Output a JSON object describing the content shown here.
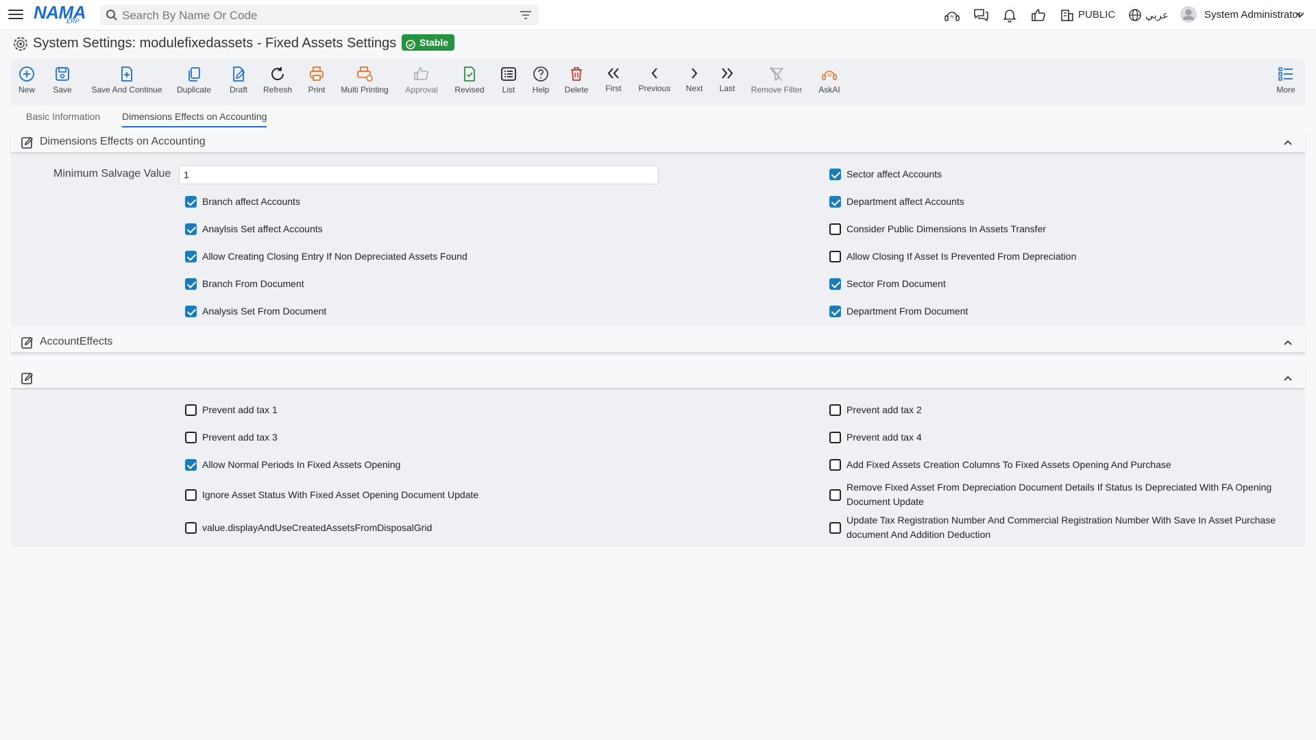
{
  "header": {
    "logo_text": "NAMA",
    "logo_sub": "ERP",
    "search_placeholder": "Search By Name Or Code",
    "public_label": "PUBLIC",
    "language_label": "عربي",
    "user_name": "System Administrator"
  },
  "page": {
    "title": "System Settings: modulefixedassets - Fixed Assets Settings",
    "status_badge": "Stable"
  },
  "toolbar": {
    "buttons": [
      {
        "label": "New",
        "icon": "plus-circle-icon",
        "color": "#1c6fd1"
      },
      {
        "label": "Save",
        "icon": "save-icon",
        "color": "#1c6fd1"
      },
      {
        "label": "Save And Continue",
        "icon": "save-continue-icon",
        "color": "#1c6fd1"
      },
      {
        "label": "Duplicate",
        "icon": "duplicate-icon",
        "color": "#1c6fd1"
      },
      {
        "label": "Draft",
        "icon": "draft-icon",
        "color": "#1c6fd1"
      },
      {
        "label": "Refresh",
        "icon": "refresh-icon",
        "color": "#222222"
      },
      {
        "label": "Print",
        "icon": "print-icon",
        "color": "#e8742b"
      },
      {
        "label": "Multi Printing",
        "icon": "multi-print-icon",
        "color": "#e8742b"
      },
      {
        "label": "Approval",
        "icon": "thumbs-up-icon",
        "color": "#aaaaaa"
      },
      {
        "label": "Revised",
        "icon": "revised-icon",
        "color": "#27923f"
      },
      {
        "label": "List",
        "icon": "list-icon",
        "color": "#222222"
      },
      {
        "label": "Help",
        "icon": "help-icon",
        "color": "#444444"
      },
      {
        "label": "Delete",
        "icon": "trash-icon",
        "color": "#c0392b"
      },
      {
        "label": "First",
        "icon": "double-chevron-left-icon",
        "color": "#222222"
      },
      {
        "label": "Previous",
        "icon": "chevron-left-icon",
        "color": "#222222"
      },
      {
        "label": "Next",
        "icon": "chevron-right-icon",
        "color": "#222222"
      },
      {
        "label": "Last",
        "icon": "double-chevron-right-icon",
        "color": "#222222"
      },
      {
        "label": "Remove Filter",
        "icon": "remove-filter-icon",
        "color": "#aaaaaa"
      },
      {
        "label": "AskAI",
        "icon": "ai-icon",
        "color": "#e8742b"
      },
      {
        "label": "More",
        "icon": "more-list-icon",
        "color": "#1c6fd1"
      }
    ]
  },
  "tabs": [
    {
      "label": "Basic Information",
      "active": false
    },
    {
      "label": "Dimensions Effects on Accounting",
      "active": true
    }
  ],
  "section_dimensions": {
    "title": "Dimensions Effects on Accounting",
    "min_salvage_label": "Minimum Salvage Value",
    "min_salvage_value": "1",
    "left_checks": [
      {
        "label": "Branch affect Accounts",
        "checked": true
      },
      {
        "label": "Anaylsis Set affect Accounts",
        "checked": true
      },
      {
        "label": "Allow Creating Closing Entry If Non Depreciated Assets Found",
        "checked": true
      },
      {
        "label": "Branch From Document",
        "checked": true
      },
      {
        "label": "Analysis Set From Document",
        "checked": true
      }
    ],
    "right_checks": [
      {
        "label": "Sector affect Accounts",
        "checked": true
      },
      {
        "label": "Department affect Accounts",
        "checked": true
      },
      {
        "label": "Consider Public Dimensions In Assets Transfer",
        "checked": false
      },
      {
        "label": "Allow Closing If Asset Is Prevented From Depreciation",
        "checked": false
      },
      {
        "label": "Sector From Document",
        "checked": true
      },
      {
        "label": "Department From Document",
        "checked": true
      }
    ]
  },
  "section_account_effects": {
    "title": "AccountEffects"
  },
  "section_untitled": {
    "title": "",
    "left_checks": [
      {
        "label": "Prevent add tax 1",
        "checked": false
      },
      {
        "label": "Prevent add tax 3",
        "checked": false
      },
      {
        "label": "Allow Normal Periods In Fixed Assets Opening",
        "checked": true
      },
      {
        "label": "Ignore Asset Status With Fixed Asset Opening Document Update",
        "checked": false
      },
      {
        "label": "value.displayAndUseCreatedAssetsFromDisposalGrid",
        "checked": false
      }
    ],
    "right_checks": [
      {
        "label": "Prevent add tax 2",
        "checked": false
      },
      {
        "label": "Prevent add tax 4",
        "checked": false
      },
      {
        "label": "Add Fixed Assets Creation Columns To Fixed Assets Opening And Purchase",
        "checked": false
      },
      {
        "label": "Remove Fixed Asset From Depreciation Document Details If Status Is Depreciated With FA Opening Document Update",
        "checked": false
      },
      {
        "label": "Update Tax Registration Number And Commercial Registration Number With Save In Asset Purchase document And Addition Deduction",
        "checked": false
      }
    ]
  }
}
